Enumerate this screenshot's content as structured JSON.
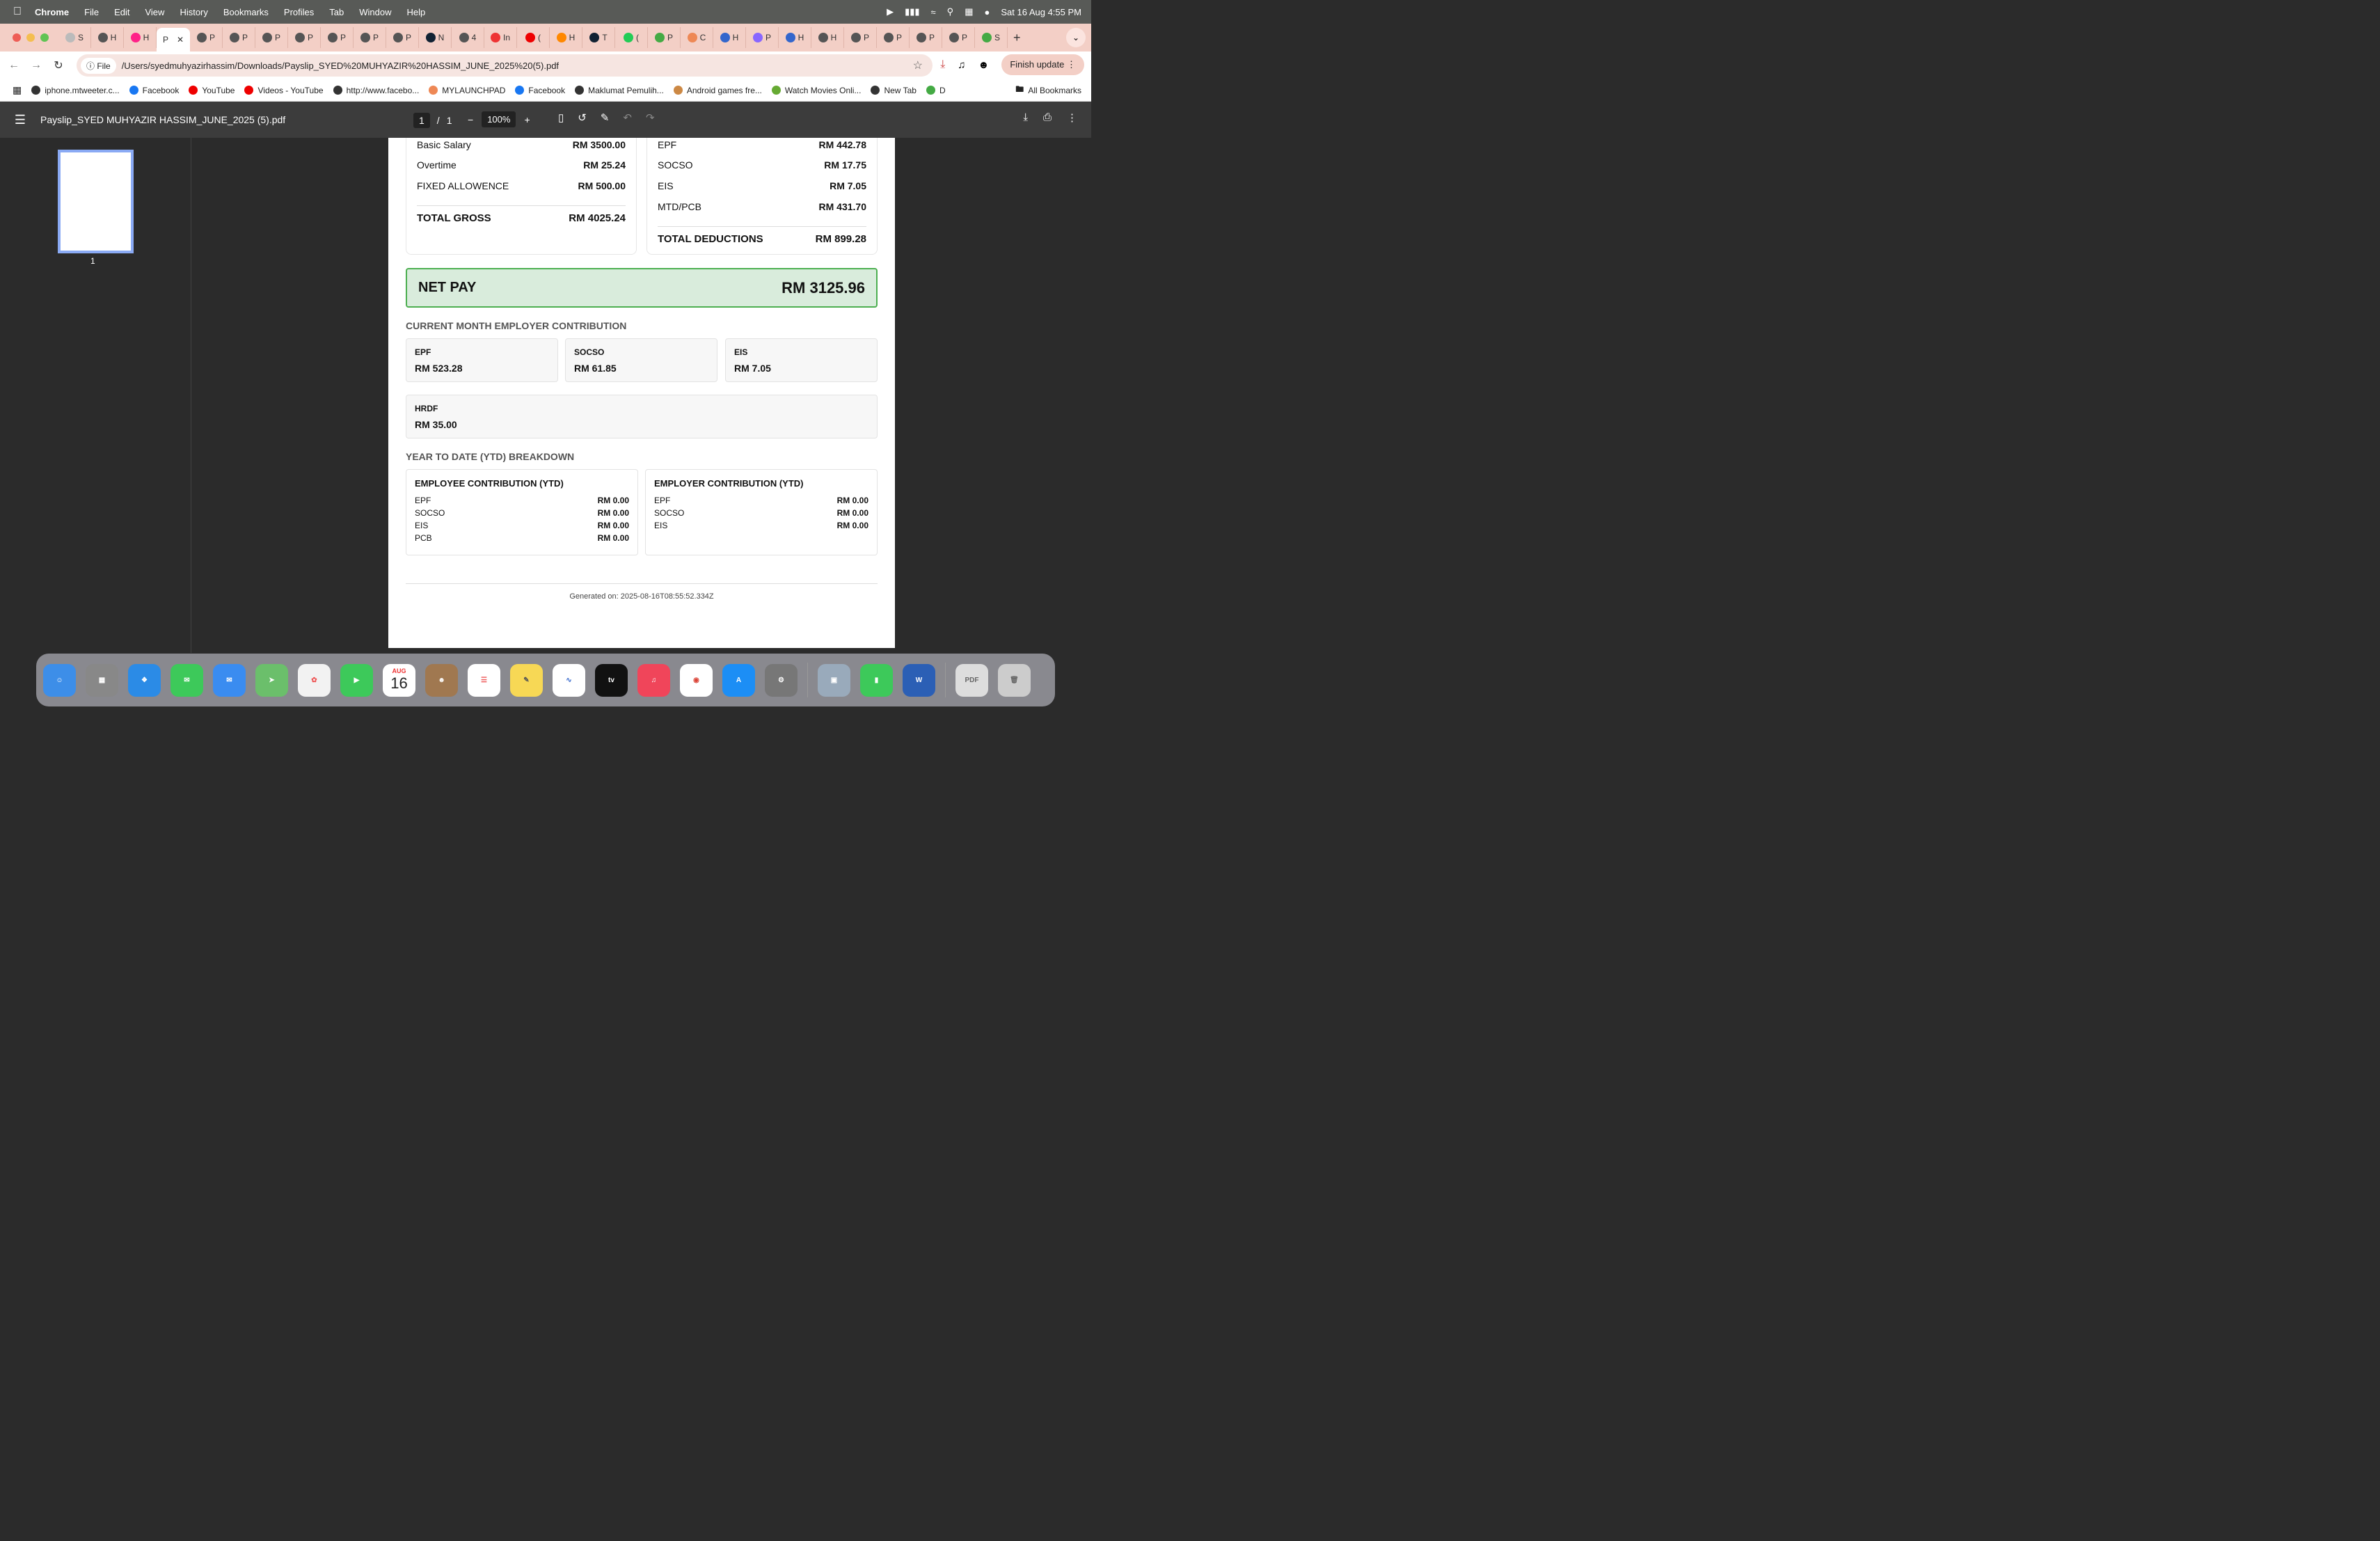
{
  "menubar": {
    "app": "Chrome",
    "items": [
      "File",
      "Edit",
      "View",
      "History",
      "Bookmarks",
      "Profiles",
      "Tab",
      "Window",
      "Help"
    ],
    "datetime": "Sat 16 Aug  4:55 PM"
  },
  "tabs": [
    {
      "label": "S"
    },
    {
      "label": "H"
    },
    {
      "label": "H"
    },
    {
      "label": "P",
      "active": true
    },
    {
      "label": "P"
    },
    {
      "label": "P"
    },
    {
      "label": "P"
    },
    {
      "label": "P"
    },
    {
      "label": "P"
    },
    {
      "label": "P"
    },
    {
      "label": "P"
    },
    {
      "label": "N"
    },
    {
      "label": "4"
    },
    {
      "label": "In"
    },
    {
      "label": "("
    },
    {
      "label": "H"
    },
    {
      "label": "T"
    },
    {
      "label": "("
    },
    {
      "label": "P"
    },
    {
      "label": "C"
    },
    {
      "label": "H"
    },
    {
      "label": "P"
    },
    {
      "label": "H"
    },
    {
      "label": "H"
    },
    {
      "label": "P"
    },
    {
      "label": "P"
    },
    {
      "label": "P"
    },
    {
      "label": "P"
    },
    {
      "label": "S"
    }
  ],
  "toolbar": {
    "file_chip": "File",
    "url": "/Users/syedmuhyazirhassim/Downloads/Payslip_SYED%20MUHYAZIR%20HASSIM_JUNE_2025%20(5).pdf",
    "finish_update": "Finish update"
  },
  "bookmarks": [
    {
      "label": "iphone.mtweeter.c...",
      "color": "#333"
    },
    {
      "label": "Facebook",
      "color": "#1877f2"
    },
    {
      "label": "YouTube",
      "color": "#e00"
    },
    {
      "label": "Videos - YouTube",
      "color": "#e00"
    },
    {
      "label": "http://www.facebo...",
      "color": "#333"
    },
    {
      "label": "MYLAUNCHPAD",
      "color": "#e85"
    },
    {
      "label": "Facebook",
      "color": "#1877f2"
    },
    {
      "label": "Maklumat Pemulih...",
      "color": "#333"
    },
    {
      "label": "Android games fre...",
      "color": "#c84"
    },
    {
      "label": "Watch Movies Onli...",
      "color": "#6a3"
    },
    {
      "label": "New Tab",
      "color": "#333"
    },
    {
      "label": "D",
      "color": "#4a4"
    }
  ],
  "all_bookmarks": "All Bookmarks",
  "pdf": {
    "filename": "Payslip_SYED MUHYAZIR HASSIM_JUNE_2025 (5).pdf",
    "page_current": "1",
    "page_total": "1",
    "zoom": "100%",
    "thumb_number": "1"
  },
  "earnings": {
    "rows": [
      {
        "label": "Basic Salary",
        "value": "RM 3500.00"
      },
      {
        "label": "Overtime",
        "value": "RM 25.24"
      },
      {
        "label": "FIXED ALLOWENCE",
        "value": "RM 500.00"
      }
    ],
    "total_label": "TOTAL GROSS",
    "total_value": "RM 4025.24"
  },
  "deductions": {
    "rows": [
      {
        "label": "EPF",
        "value": "RM 442.78"
      },
      {
        "label": "SOCSO",
        "value": "RM 17.75"
      },
      {
        "label": "EIS",
        "value": "RM 7.05"
      },
      {
        "label": "MTD/PCB",
        "value": "RM 431.70"
      }
    ],
    "total_label": "TOTAL DEDUCTIONS",
    "total_value": "RM 899.28"
  },
  "net_pay": {
    "label": "NET PAY",
    "value": "RM 3125.96"
  },
  "employer_contribution": {
    "title": "CURRENT MONTH EMPLOYER CONTRIBUTION",
    "items": [
      {
        "label": "EPF",
        "value": "RM 523.28"
      },
      {
        "label": "SOCSO",
        "value": "RM 61.85"
      },
      {
        "label": "EIS",
        "value": "RM 7.05"
      },
      {
        "label": "HRDF",
        "value": "RM 35.00"
      }
    ]
  },
  "ytd": {
    "title": "YEAR TO DATE (YTD) BREAKDOWN",
    "employee": {
      "title": "EMPLOYEE CONTRIBUTION (YTD)",
      "rows": [
        {
          "label": "EPF",
          "value": "RM 0.00"
        },
        {
          "label": "SOCSO",
          "value": "RM 0.00"
        },
        {
          "label": "EIS",
          "value": "RM 0.00"
        },
        {
          "label": "PCB",
          "value": "RM 0.00"
        }
      ]
    },
    "employer": {
      "title": "EMPLOYER CONTRIBUTION (YTD)",
      "rows": [
        {
          "label": "EPF",
          "value": "RM 0.00"
        },
        {
          "label": "SOCSO",
          "value": "RM 0.00"
        },
        {
          "label": "EIS",
          "value": "RM 0.00"
        }
      ]
    }
  },
  "generated": "Generated on: 2025-08-16T08:55:52.334Z",
  "dock": {
    "calendar_month": "AUG",
    "calendar_day": "16",
    "apps": [
      "Finder",
      "Launchpad",
      "Safari",
      "Messages",
      "Mail",
      "Maps",
      "Photos",
      "FaceTime",
      "Calendar",
      "Contacts",
      "Reminders",
      "Notes",
      "Freeform",
      "TV",
      "Music",
      "Chrome",
      "App Store",
      "System Settings",
      "Preview",
      "Numbers",
      "Word",
      "Downloads",
      "Trash"
    ]
  },
  "colors": {
    "tabstrip": "#f3cfc6",
    "netpay_bg": "#d9ecdc",
    "netpay_border": "#4caf50"
  }
}
